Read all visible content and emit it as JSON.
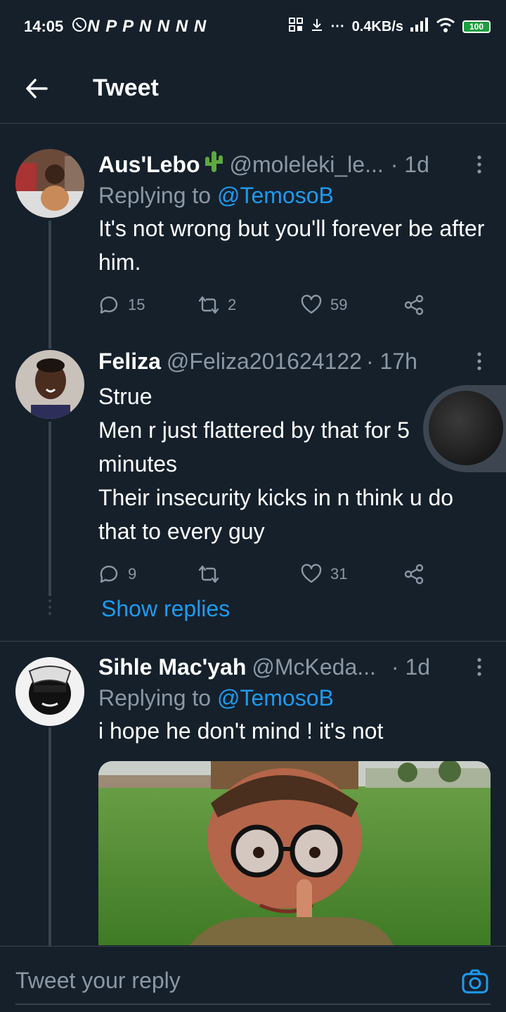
{
  "status_bar": {
    "time": "14:05",
    "notifications": "N P P N N N N",
    "network_speed": "0.4KB/s",
    "battery": "100"
  },
  "header": {
    "title": "Tweet",
    "back_icon": "arrow-left-icon"
  },
  "tweets": [
    {
      "name": "Aus'Lebo",
      "emoji": "cactus-icon",
      "handle": "@moleleki_le...",
      "time": "· 1d",
      "replying_label": "Replying to",
      "replying_to": "@TemosoB",
      "text": "It's not wrong but you'll forever be after him.",
      "replies": "15",
      "retweets": "2",
      "likes": "59"
    },
    {
      "name": "Feliza",
      "handle": "@Feliza201624122",
      "time": "· 17h",
      "text_lines": [
        "Strue",
        "Men r just flattered by that for 5 minutes",
        "Their insecurity kicks in n think u do that to every guy"
      ],
      "replies": "9",
      "retweets": "",
      "likes": "31"
    },
    {
      "name": "Sihle Mac'yah",
      "handle": "@McKeda...",
      "time": "· 1d",
      "replying_label": "Replying to",
      "replying_to": "@TemosoB",
      "text": "i hope he don't mind ! it's not"
    }
  ],
  "show_replies": "Show replies",
  "reply_bar": {
    "placeholder": "Tweet your reply"
  },
  "colors": {
    "background": "#15202b",
    "accent": "#1d9bf0",
    "secondary_text": "#8b98a5",
    "border": "#38444d"
  }
}
